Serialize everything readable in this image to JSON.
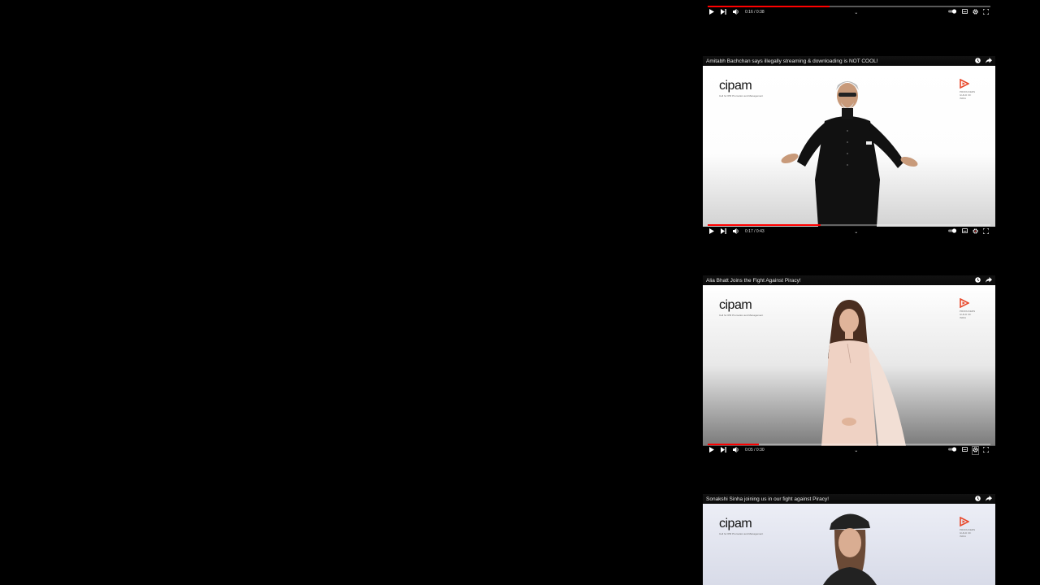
{
  "players": [
    {
      "title": "",
      "time": "0:16 / 0:38",
      "progress": 0.43
    },
    {
      "title": "Amitabh Bachchan says illegally streaming & downloading is NOT COOL!",
      "time": "0:17 / 0:43",
      "progress": 0.4
    },
    {
      "title": "Alia Bhatt Joins the Fight Against Piracy!",
      "time": "0:05 / 0:30",
      "progress": 0.18
    },
    {
      "title": "Sonakshi Sinha joining us in our fight against Piracy!",
      "time": "",
      "progress": 0
    }
  ],
  "logos": {
    "cipam": "cipam",
    "cipam_sub": "Cell for IPR Promotion and Management",
    "guild": "PRODUCERS GUILD OF INDIA"
  },
  "colors": {
    "progress": "#ff0000",
    "accent": "#e8482a"
  },
  "icons": [
    "play-icon",
    "next-icon",
    "volume-icon",
    "chevron-down-icon",
    "autoplay-icon",
    "subtitles-icon",
    "settings-icon",
    "fullscreen-icon",
    "watch-later-icon",
    "share-icon"
  ]
}
